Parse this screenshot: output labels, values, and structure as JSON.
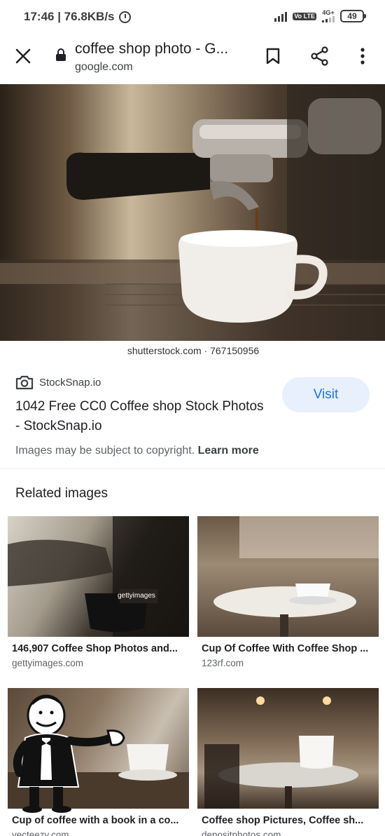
{
  "status_bar": {
    "time_speed": "17:46 | 76.8KB/s",
    "network": "4G+",
    "volte": "Vo LTE",
    "battery": "49"
  },
  "app_bar": {
    "title": "coffee shop photo - G...",
    "domain": "google.com"
  },
  "hero": {
    "caption": "shutterstock.com · 767150956"
  },
  "source": {
    "name": "StockSnap.io",
    "visit_label": "Visit",
    "title": "1042 Free CC0 Coffee shop Stock Photos - StockSnap.io",
    "copyright": "Images may be subject to copyright.",
    "learn_more": "Learn more"
  },
  "related": {
    "heading": "Related images",
    "items": [
      {
        "caption": "146,907 Coffee Shop Photos and...",
        "site": "gettyimages.com",
        "watermark": "gettyimages"
      },
      {
        "caption": "Cup Of Coffee With Coffee Shop ...",
        "site": "123rf.com"
      },
      {
        "caption": "Cup of coffee with a book in a co...",
        "site": "vecteezy.com"
      },
      {
        "caption": "Coffee shop Pictures, Coffee sh...",
        "site": "depositphotos.com"
      }
    ]
  }
}
